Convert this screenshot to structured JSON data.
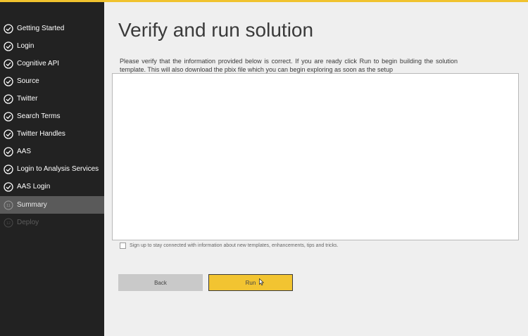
{
  "colors": {
    "accent": "#f0c22e",
    "sidebar_bg": "#222222",
    "active_item_bg": "#5a5a5a"
  },
  "sidebar": {
    "items": [
      {
        "label": "Getting Started",
        "icon": "check-circle-icon",
        "state": "done"
      },
      {
        "label": "Login",
        "icon": "check-circle-icon",
        "state": "done"
      },
      {
        "label": "Cognitive API",
        "icon": "check-circle-icon",
        "state": "done"
      },
      {
        "label": "Source",
        "icon": "check-circle-icon",
        "state": "done"
      },
      {
        "label": "Twitter",
        "icon": "check-circle-icon",
        "state": "done"
      },
      {
        "label": "Search Terms",
        "icon": "check-circle-icon",
        "state": "done"
      },
      {
        "label": "Twitter Handles",
        "icon": "check-circle-icon",
        "state": "done"
      },
      {
        "label": "AAS",
        "icon": "check-circle-icon",
        "state": "done"
      },
      {
        "label": "Login to Analysis Services",
        "icon": "check-circle-icon",
        "state": "done"
      },
      {
        "label": "AAS Login",
        "icon": "check-circle-icon",
        "state": "done"
      },
      {
        "label": "Summary",
        "icon": "numbered-circle-icon",
        "number": "11",
        "state": "active"
      },
      {
        "label": "Deploy",
        "icon": "numbered-circle-icon",
        "number": "12",
        "state": "disabled"
      }
    ]
  },
  "main": {
    "title": "Verify and run solution",
    "description": "Please verify that the information provided below is correct. If you are ready click Run to begin building the solution template. This will also download the pbix file which you can begin exploring as soon as the setup",
    "signup_label": "Sign up to stay connected with information about new templates, enhancements, tips and tricks.",
    "signup_checked": false,
    "back_label": "Back",
    "run_label": "Run"
  }
}
